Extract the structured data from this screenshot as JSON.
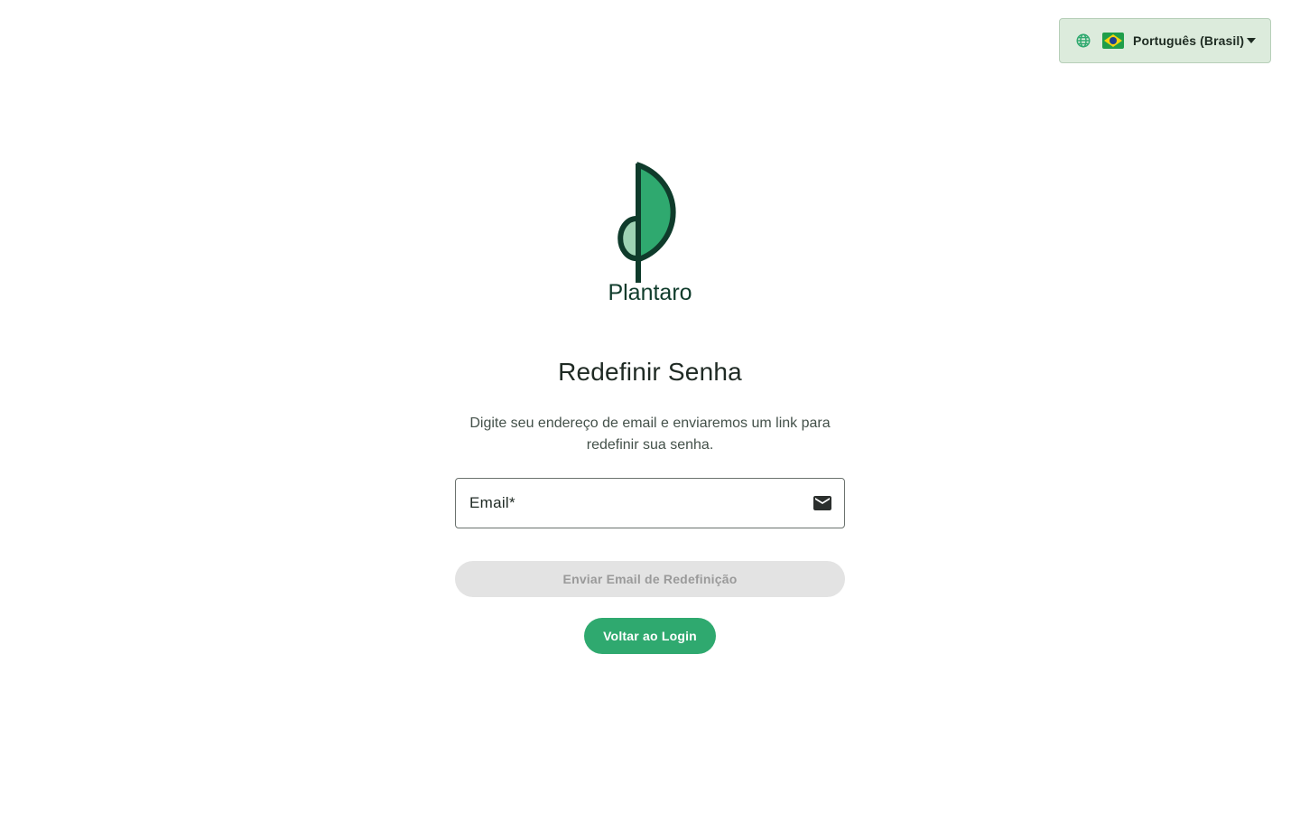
{
  "language_selector": {
    "label": "Português (Brasil)",
    "globe_icon": "globe-icon",
    "flag_icon": "brazil-flag-icon",
    "caret_icon": "caret-down-icon"
  },
  "brand": {
    "name": "Plantaro",
    "colors": {
      "primary": "#2fa96f",
      "dark": "#0f3b2b",
      "light": "#9ed3b4"
    }
  },
  "reset": {
    "title": "Redefinir Senha",
    "description": "Digite seu endereço de email e enviaremos um link para redefinir sua senha.",
    "email_label": "Email",
    "email_required_mark": "*",
    "email_value": "",
    "email_icon": "mail-icon",
    "submit_label": "Enviar Email de Redefinição",
    "back_label": "Voltar ao Login"
  },
  "colors": {
    "accent": "#2fa96f",
    "selector_bg": "#dcebdc",
    "disabled_bg": "#e3e3e3",
    "disabled_text": "#9a9a9a"
  }
}
